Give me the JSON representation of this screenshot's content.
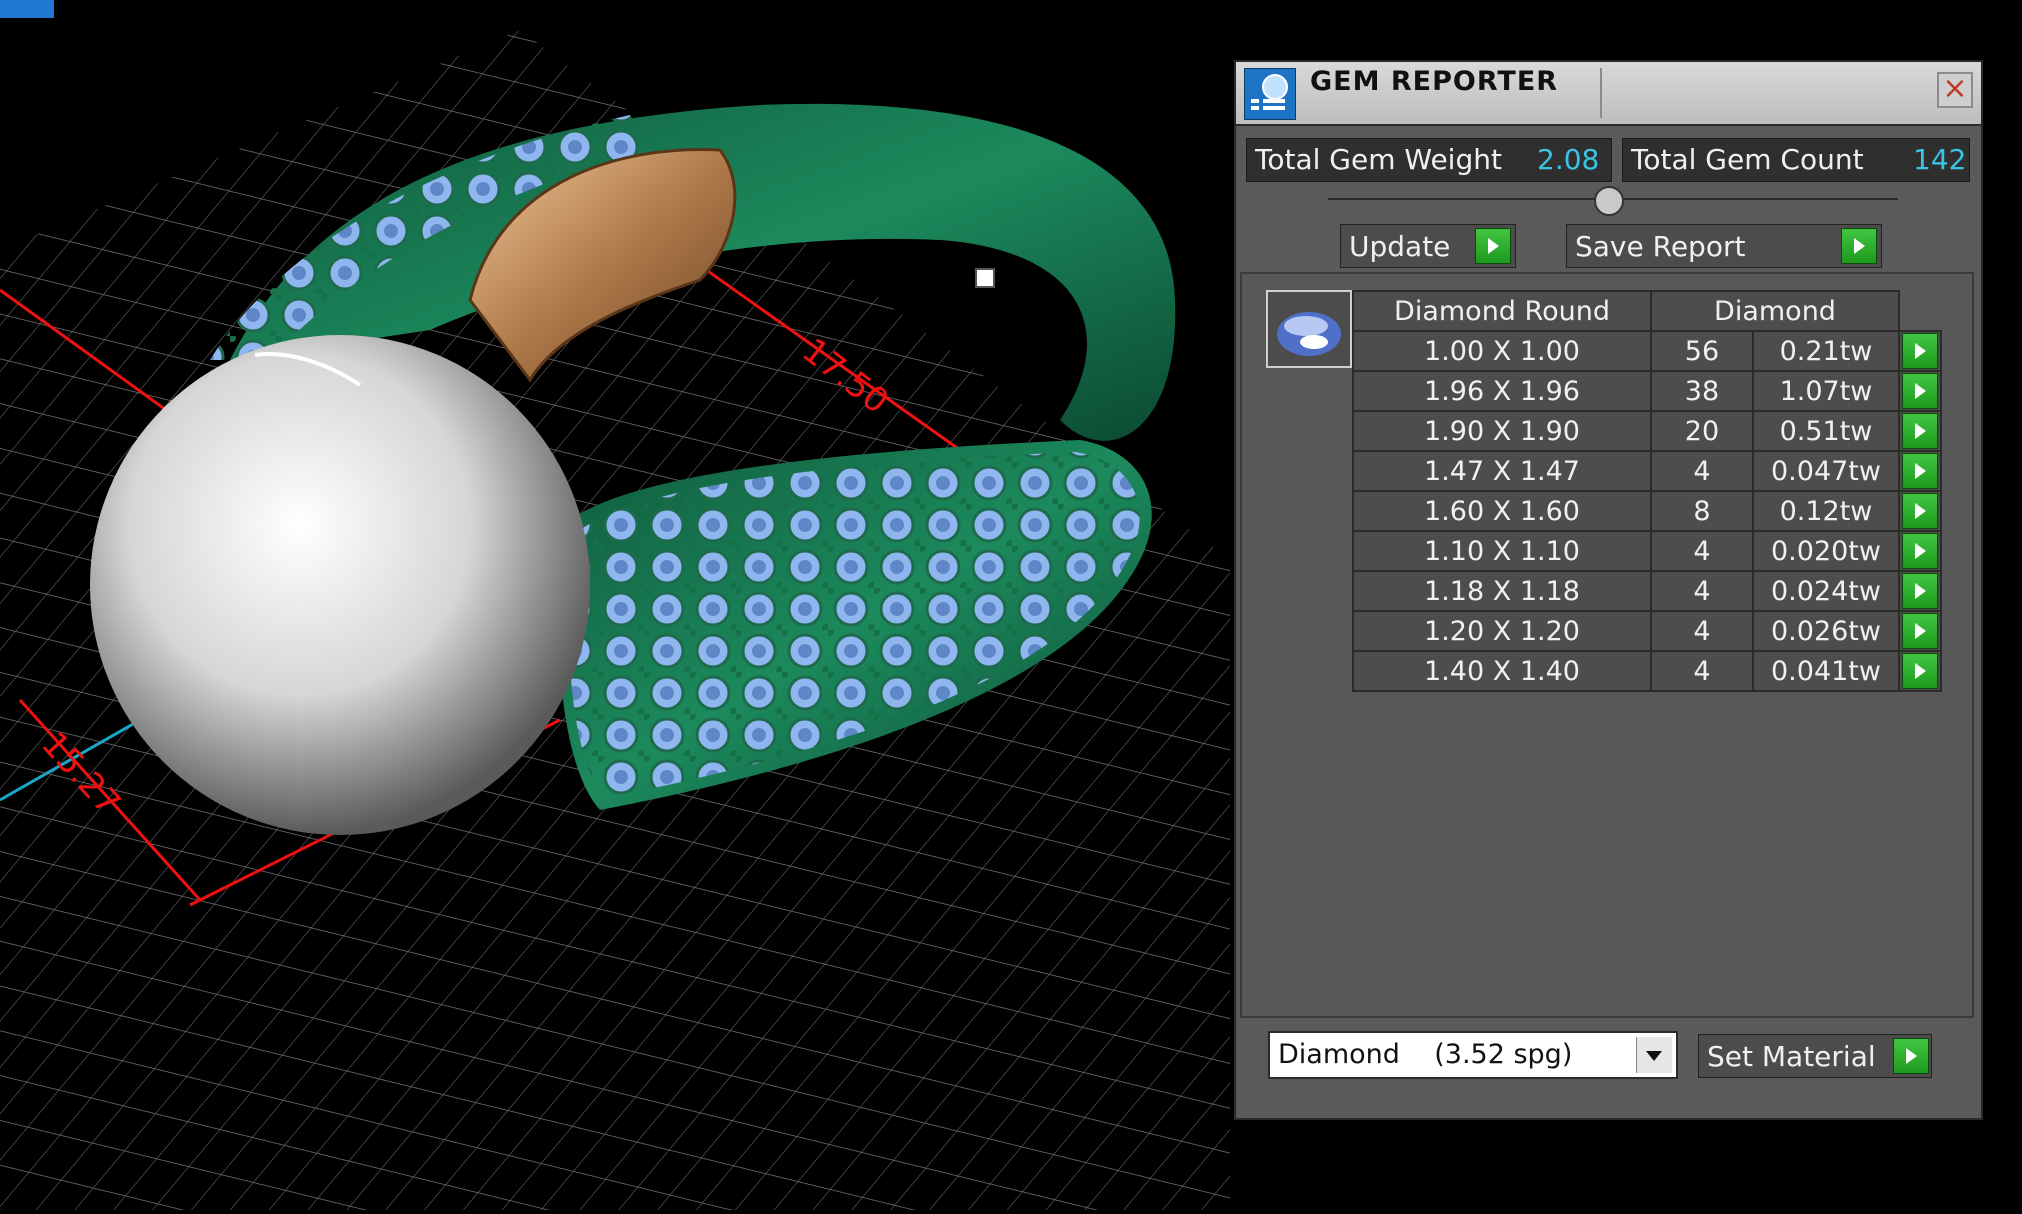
{
  "panel": {
    "title": "GEM REPORTER",
    "total_weight_label": "Total Gem Weight",
    "total_weight_value": "2.08",
    "total_count_label": "Total Gem Count",
    "total_count_value": "142",
    "update_label": "Update",
    "save_report_label": "Save Report",
    "table": {
      "header_shape": "Diamond Round",
      "header_material": "Diamond",
      "rows": [
        {
          "size": "1.00 X 1.00",
          "count": "56",
          "weight": "0.21tw"
        },
        {
          "size": "1.96 X 1.96",
          "count": "38",
          "weight": "1.07tw"
        },
        {
          "size": "1.90 X 1.90",
          "count": "20",
          "weight": "0.51tw"
        },
        {
          "size": "1.47 X 1.47",
          "count": "4",
          "weight": "0.047tw"
        },
        {
          "size": "1.60 X 1.60",
          "count": "8",
          "weight": "0.12tw"
        },
        {
          "size": "1.10 X 1.10",
          "count": "4",
          "weight": "0.020tw"
        },
        {
          "size": "1.18 X 1.18",
          "count": "4",
          "weight": "0.024tw"
        },
        {
          "size": "1.20 X 1.20",
          "count": "4",
          "weight": "0.026tw"
        },
        {
          "size": "1.40 X 1.40",
          "count": "4",
          "weight": "0.041tw"
        }
      ]
    },
    "material_select": "Diamond    (3.52 spg)",
    "set_material_label": "Set Material"
  },
  "viewport": {
    "dimension_1": "17.50",
    "dimension_2": "15.27"
  },
  "icons": [
    "gem-reporter-icon",
    "close-icon",
    "go-arrow-icon",
    "dropdown-arrow-icon",
    "gem-thumbnail-icon"
  ]
}
